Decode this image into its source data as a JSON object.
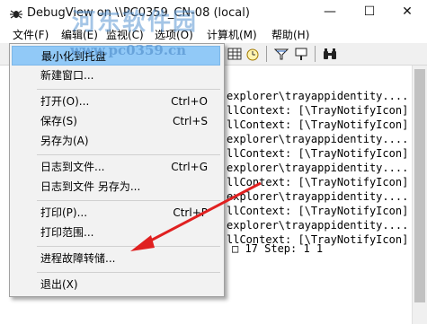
{
  "window": {
    "title": "DebugView on \\\\PC0359_CN-08 (local)"
  },
  "menubar": [
    {
      "label": "文件(F)"
    },
    {
      "label": "编辑(E)"
    },
    {
      "label": "监视(C)"
    },
    {
      "label": "选项(O)"
    },
    {
      "label": "计算机(M)"
    },
    {
      "label": "帮助(H)"
    }
  ],
  "watermark": {
    "text": "河东软件园",
    "url": "www.pc0359.cn"
  },
  "file_menu": {
    "items": [
      {
        "label": "最小化到托盘",
        "shortcut": "",
        "highlighted": true
      },
      {
        "label": "新建窗口...",
        "shortcut": ""
      },
      {
        "label": "打开(O)...",
        "shortcut": "Ctrl+O"
      },
      {
        "label": "保存(S)",
        "shortcut": "Ctrl+S"
      },
      {
        "label": "另存为(A)",
        "shortcut": ""
      },
      {
        "label": "日志到文件...",
        "shortcut": "Ctrl+G"
      },
      {
        "label": "日志到文件 另存为...",
        "shortcut": ""
      },
      {
        "label": "打印(P)...",
        "shortcut": "Ctrl+P"
      },
      {
        "label": "打印范围...",
        "shortcut": ""
      },
      {
        "label": "进程故障转储...",
        "shortcut": ""
      },
      {
        "label": "退出(X)",
        "shortcut": ""
      }
    ]
  },
  "log_lines": [
    "explorer\\trayappidentity....",
    "llContext: [\\TrayNotifyIcon]",
    "llContext: [\\TrayNotifyIcon]",
    "explorer\\trayappidentity....",
    "llContext: [\\TrayNotifyIcon]",
    "explorer\\trayappidentity....",
    "llContext: [\\TrayNotifyIcon]",
    "explorer\\trayappidentity....",
    "llContext: [\\TrayNotifyIcon]",
    "explorer\\trayappidentity....",
    "llContext: [\\TrayNotifyIcon]",
    "□ 17 Step: 1 1"
  ],
  "colors": {
    "menu_highlight": "#91c9f7",
    "arrow": "#e02020",
    "watermark": "#5a96d2"
  }
}
